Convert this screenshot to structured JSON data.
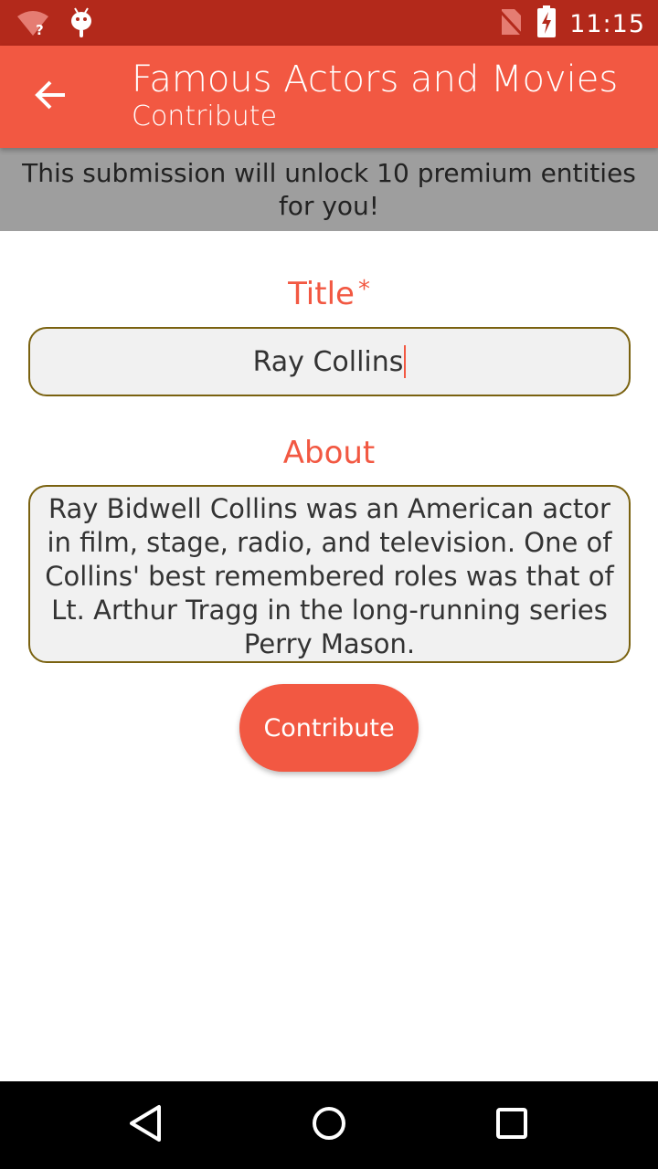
{
  "status_bar": {
    "time": "11:15",
    "icons": [
      "wifi-unknown-icon",
      "android-debug-icon",
      "no-sim-icon",
      "battery-charging-icon"
    ]
  },
  "app_bar": {
    "title": "Famous Actors and Movies",
    "subtitle": "Contribute",
    "back_icon": "arrow-back-icon"
  },
  "banner": {
    "text": "This submission will unlock 10 premium entities for you!"
  },
  "form": {
    "title_label": "Title",
    "title_required_marker": "*",
    "title_value": "Ray Collins",
    "about_label": "About",
    "about_value": "Ray Bidwell Collins was an American actor in film, stage, radio, and television. One of Collins' best remembered roles was that of Lt. Arthur Tragg in the long-running series Perry Mason.",
    "submit_label": "Contribute"
  },
  "nav_bar": {
    "icons": [
      "nav-back-icon",
      "nav-home-icon",
      "nav-recents-icon"
    ]
  },
  "colors": {
    "status_bar": "#b3291b",
    "app_bar": "#f25842",
    "accent": "#f25842",
    "banner": "#9e9e9e",
    "field_border": "#7a6210",
    "field_background": "#f1f1f1"
  }
}
